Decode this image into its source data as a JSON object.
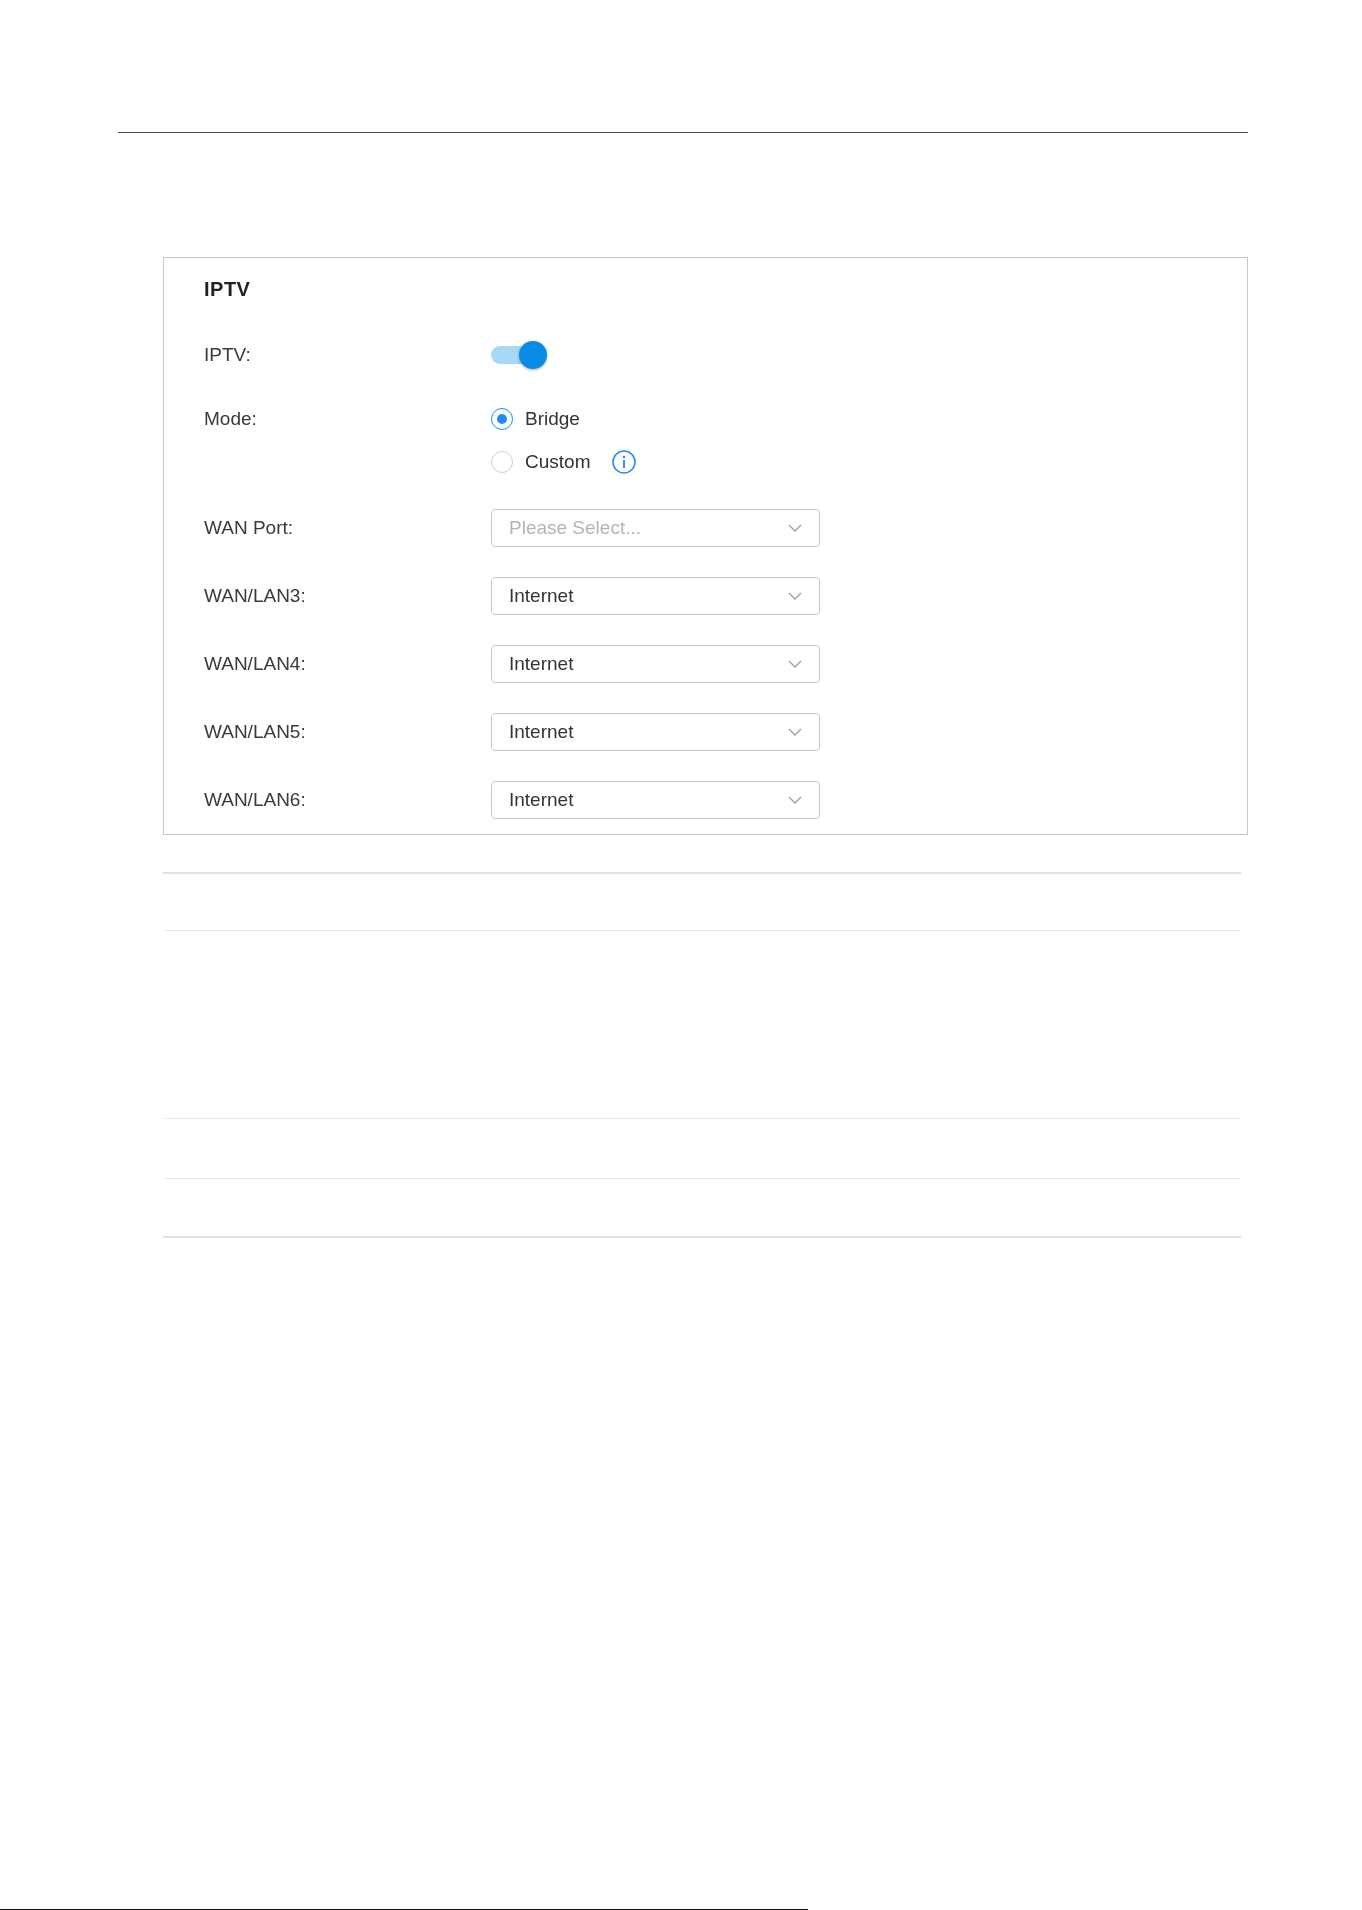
{
  "panel": {
    "title": "IPTV",
    "fields": [
      {
        "kind": "toggle",
        "label": "IPTV:",
        "on": true
      },
      {
        "kind": "radio",
        "label": "Mode:",
        "options": [
          {
            "label": "Bridge",
            "selected": true,
            "info": false
          },
          {
            "label": "Custom",
            "selected": false,
            "info": true
          }
        ]
      },
      {
        "kind": "select",
        "label": "WAN Port:",
        "placeholder": "Please Select..."
      },
      {
        "kind": "select",
        "label": "WAN/LAN3:",
        "value": "Internet"
      },
      {
        "kind": "select",
        "label": "WAN/LAN4:",
        "value": "Internet"
      },
      {
        "kind": "select",
        "label": "WAN/LAN5:",
        "value": "Internet"
      },
      {
        "kind": "select",
        "label": "WAN/LAN6:",
        "value": "Internet"
      }
    ]
  }
}
